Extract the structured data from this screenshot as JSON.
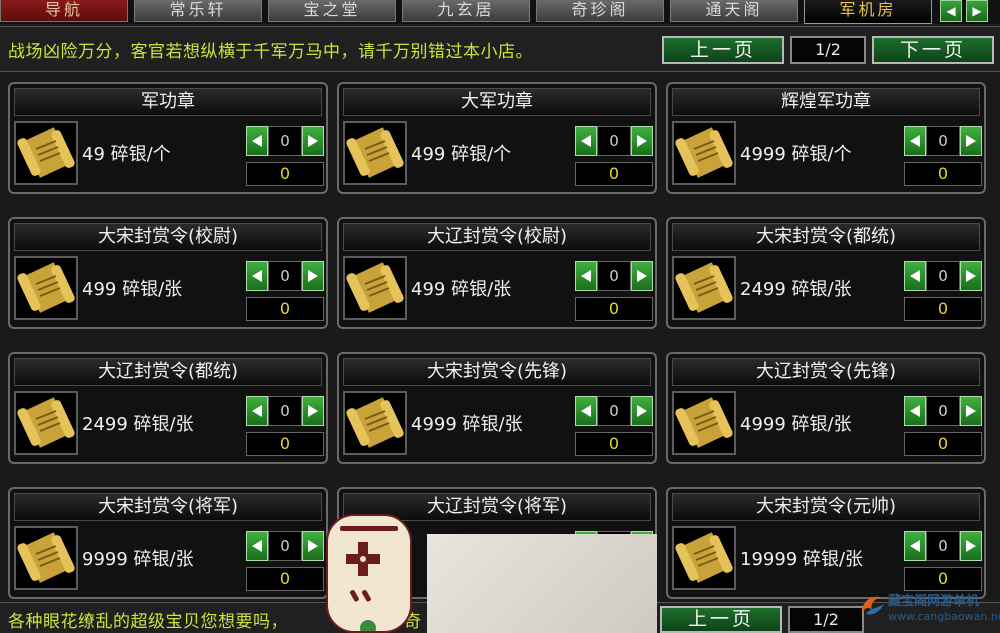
{
  "tabs": [
    {
      "label": "导航"
    },
    {
      "label": "常乐轩"
    },
    {
      "label": "宝之堂"
    },
    {
      "label": "九玄居"
    },
    {
      "label": "奇珍阁"
    },
    {
      "label": "通天阁"
    },
    {
      "label": "军机房"
    }
  ],
  "active_tab": "军机房",
  "header": {
    "slogan": "战场凶险万分，客官若想纵横于千军万马中，请千万别错过本小店。",
    "prev_label": "上一页",
    "next_label": "下一页",
    "page_indicator": "1/2"
  },
  "items": [
    {
      "name": "军功章",
      "price": "49 碎银/个",
      "qty": "0",
      "total": "0"
    },
    {
      "name": "大军功章",
      "price": "499 碎银/个",
      "qty": "0",
      "total": "0"
    },
    {
      "name": "辉煌军功章",
      "price": "4999 碎银/个",
      "qty": "0",
      "total": "0"
    },
    {
      "name": "大宋封赏令(校尉)",
      "price": "499 碎银/张",
      "qty": "0",
      "total": "0"
    },
    {
      "name": "大辽封赏令(校尉)",
      "price": "499 碎银/张",
      "qty": "0",
      "total": "0"
    },
    {
      "name": "大宋封赏令(都统)",
      "price": "2499 碎银/张",
      "qty": "0",
      "total": "0"
    },
    {
      "name": "大辽封赏令(都统)",
      "price": "2499 碎银/张",
      "qty": "0",
      "total": "0"
    },
    {
      "name": "大宋封赏令(先锋)",
      "price": "4999 碎银/张",
      "qty": "0",
      "total": "0"
    },
    {
      "name": "大辽封赏令(先锋)",
      "price": "4999 碎银/张",
      "qty": "0",
      "total": "0"
    },
    {
      "name": "大宋封赏令(将军)",
      "price": "9999 碎银/张",
      "qty": "0",
      "total": "0"
    },
    {
      "name": "大辽封赏令(将军)",
      "price": "",
      "qty": "",
      "total": ""
    },
    {
      "name": "大宋封赏令(元帅)",
      "price": "19999 碎银/张",
      "qty": "0",
      "total": "0"
    }
  ],
  "footer": {
    "text": "各种眼花缭乱的超级宝贝您想要吗，",
    "text_tail": "奇",
    "prev_label": "上一页",
    "page_indicator": "1/2"
  },
  "watermark": {
    "brand": "藏宝阁网游单机",
    "url": "www.cangbaowan.net"
  },
  "icons": {
    "item": "scroll-icon",
    "decrease": "arrow-left-icon",
    "increase": "arrow-right-icon"
  },
  "colors": {
    "slogan": "#cfe23a",
    "total": "#e8d62a",
    "active_tab_text": "#e8c44a",
    "button_green": "#1f6e2c"
  }
}
